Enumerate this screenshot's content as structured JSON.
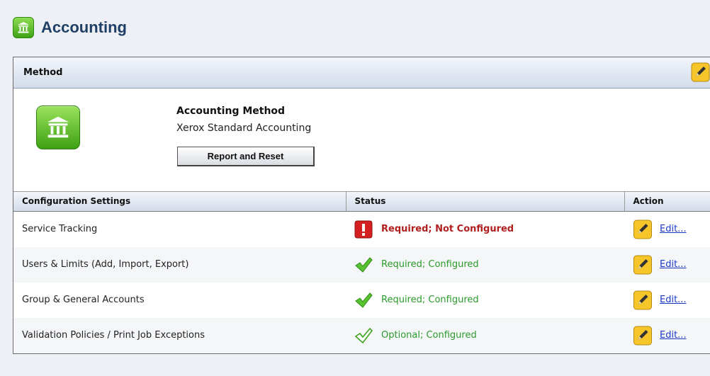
{
  "header": {
    "title": "Accounting",
    "icon": "bank-icon"
  },
  "method": {
    "section_title": "Method",
    "edit_icon": "pencil-icon",
    "accounting_method_label": "Accounting Method",
    "accounting_method_value": "Xerox Standard Accounting",
    "report_reset_label": "Report and Reset"
  },
  "table": {
    "columns": [
      "Configuration Settings",
      "Status",
      "Action"
    ],
    "rows": [
      {
        "setting": "Service Tracking",
        "status": "Required; Not Configured",
        "status_icon": "error-icon",
        "action": "Edit..."
      },
      {
        "setting": "Users & Limits (Add, Import, Export)",
        "status": "Required; Configured",
        "status_icon": "check-icon",
        "action": "Edit..."
      },
      {
        "setting": "Group & General Accounts",
        "status": "Required; Configured",
        "status_icon": "check-icon",
        "action": "Edit..."
      },
      {
        "setting": "Validation Policies / Print Job Exceptions",
        "status": "Optional; Configured",
        "status_icon": "check-outline-icon",
        "action": "Edit..."
      }
    ]
  },
  "colors": {
    "error": "#b01e1e",
    "ok": "#2a9a2a",
    "link": "#1a37c8",
    "title": "#1f3f66"
  }
}
